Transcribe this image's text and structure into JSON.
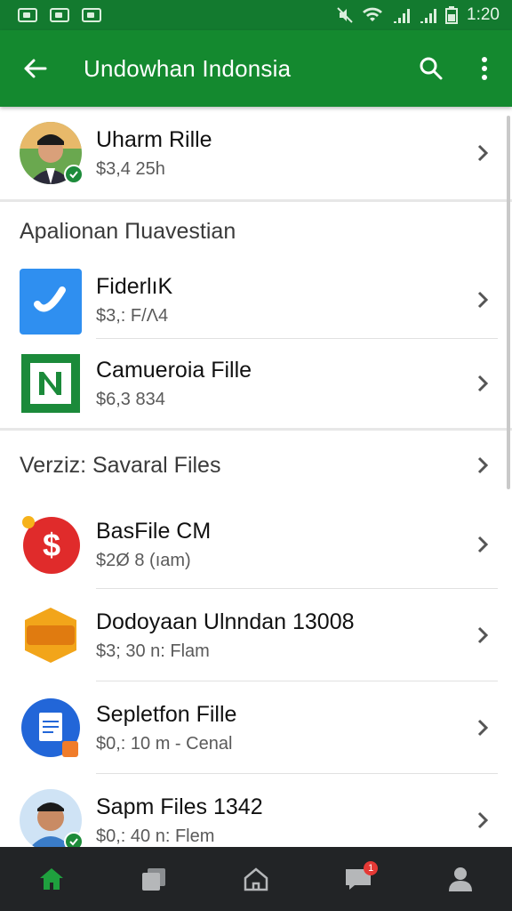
{
  "status_bar": {
    "time": "1:20"
  },
  "app_bar": {
    "title": "Undowhan Indonsia"
  },
  "profile": {
    "name": "Uharm Rille",
    "sub": "$3,4 25h"
  },
  "sections": [
    {
      "header": "Apalionan Πuavestian",
      "items": [
        {
          "name": "FiderlıK",
          "sub": "$3,: F/Λ4",
          "icon": "phone-app-icon",
          "color": "#2f8ff0"
        },
        {
          "name": "Camueroia Fille",
          "sub": "$6,3 834",
          "icon": "n-app-icon",
          "color": "#1b8a3a"
        }
      ]
    },
    {
      "header": "Verziz: Savaral Files",
      "items": [
        {
          "name": "BasFile CM",
          "sub": "$2Ø 8 (ıam)",
          "icon": "dollar-coin-icon",
          "color": "#e02b2b"
        },
        {
          "name": "Dodoyaan Ulnndan 13008",
          "sub": "$3; 30 n: Flam",
          "icon": "kos-badge-icon",
          "color": "#f2a51a"
        },
        {
          "name": "Sepletfon Fille",
          "sub": "$0,: 10 m - Cenal",
          "icon": "document-icon",
          "color": "#2266d8"
        },
        {
          "name": "Sapm Files 1342",
          "sub": "$0,: 40 n: Flem",
          "icon": "person-avatar-icon",
          "color": "#3a7cc8"
        }
      ]
    }
  ],
  "nav": {
    "messages_badge": "1"
  }
}
